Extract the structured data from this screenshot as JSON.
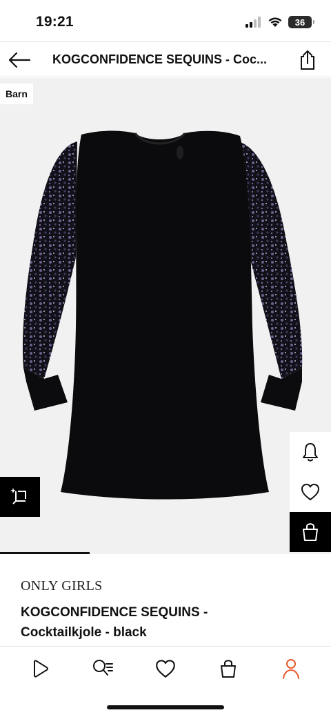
{
  "status_bar": {
    "time": "19:21",
    "battery": "36"
  },
  "header": {
    "title": "KOGCONFIDENCE SEQUINS - Coc..."
  },
  "product_image": {
    "badge": "Barn",
    "gallery_progress": 0.27
  },
  "product": {
    "brand": "ONLY GIRLS",
    "name_line1": "KOGCONFIDENCE SEQUINS -",
    "name_line2": "Cocktailkjole - black"
  },
  "icons": {
    "back": "arrow-left-icon",
    "share": "share-icon",
    "ar": "ar-view-icon",
    "notify": "bell-icon",
    "wishlist": "heart-icon",
    "bag": "shopping-bag-icon"
  },
  "bottom_nav": [
    {
      "name": "discover",
      "icon": "play-icon"
    },
    {
      "name": "search",
      "icon": "search-filter-icon"
    },
    {
      "name": "wishlist",
      "icon": "heart-icon"
    },
    {
      "name": "bag",
      "icon": "bag-icon"
    },
    {
      "name": "profile",
      "icon": "person-icon"
    }
  ],
  "colors": {
    "accent": "#e8592c",
    "dark": "#000000",
    "image_bg": "#f1f1f1"
  }
}
